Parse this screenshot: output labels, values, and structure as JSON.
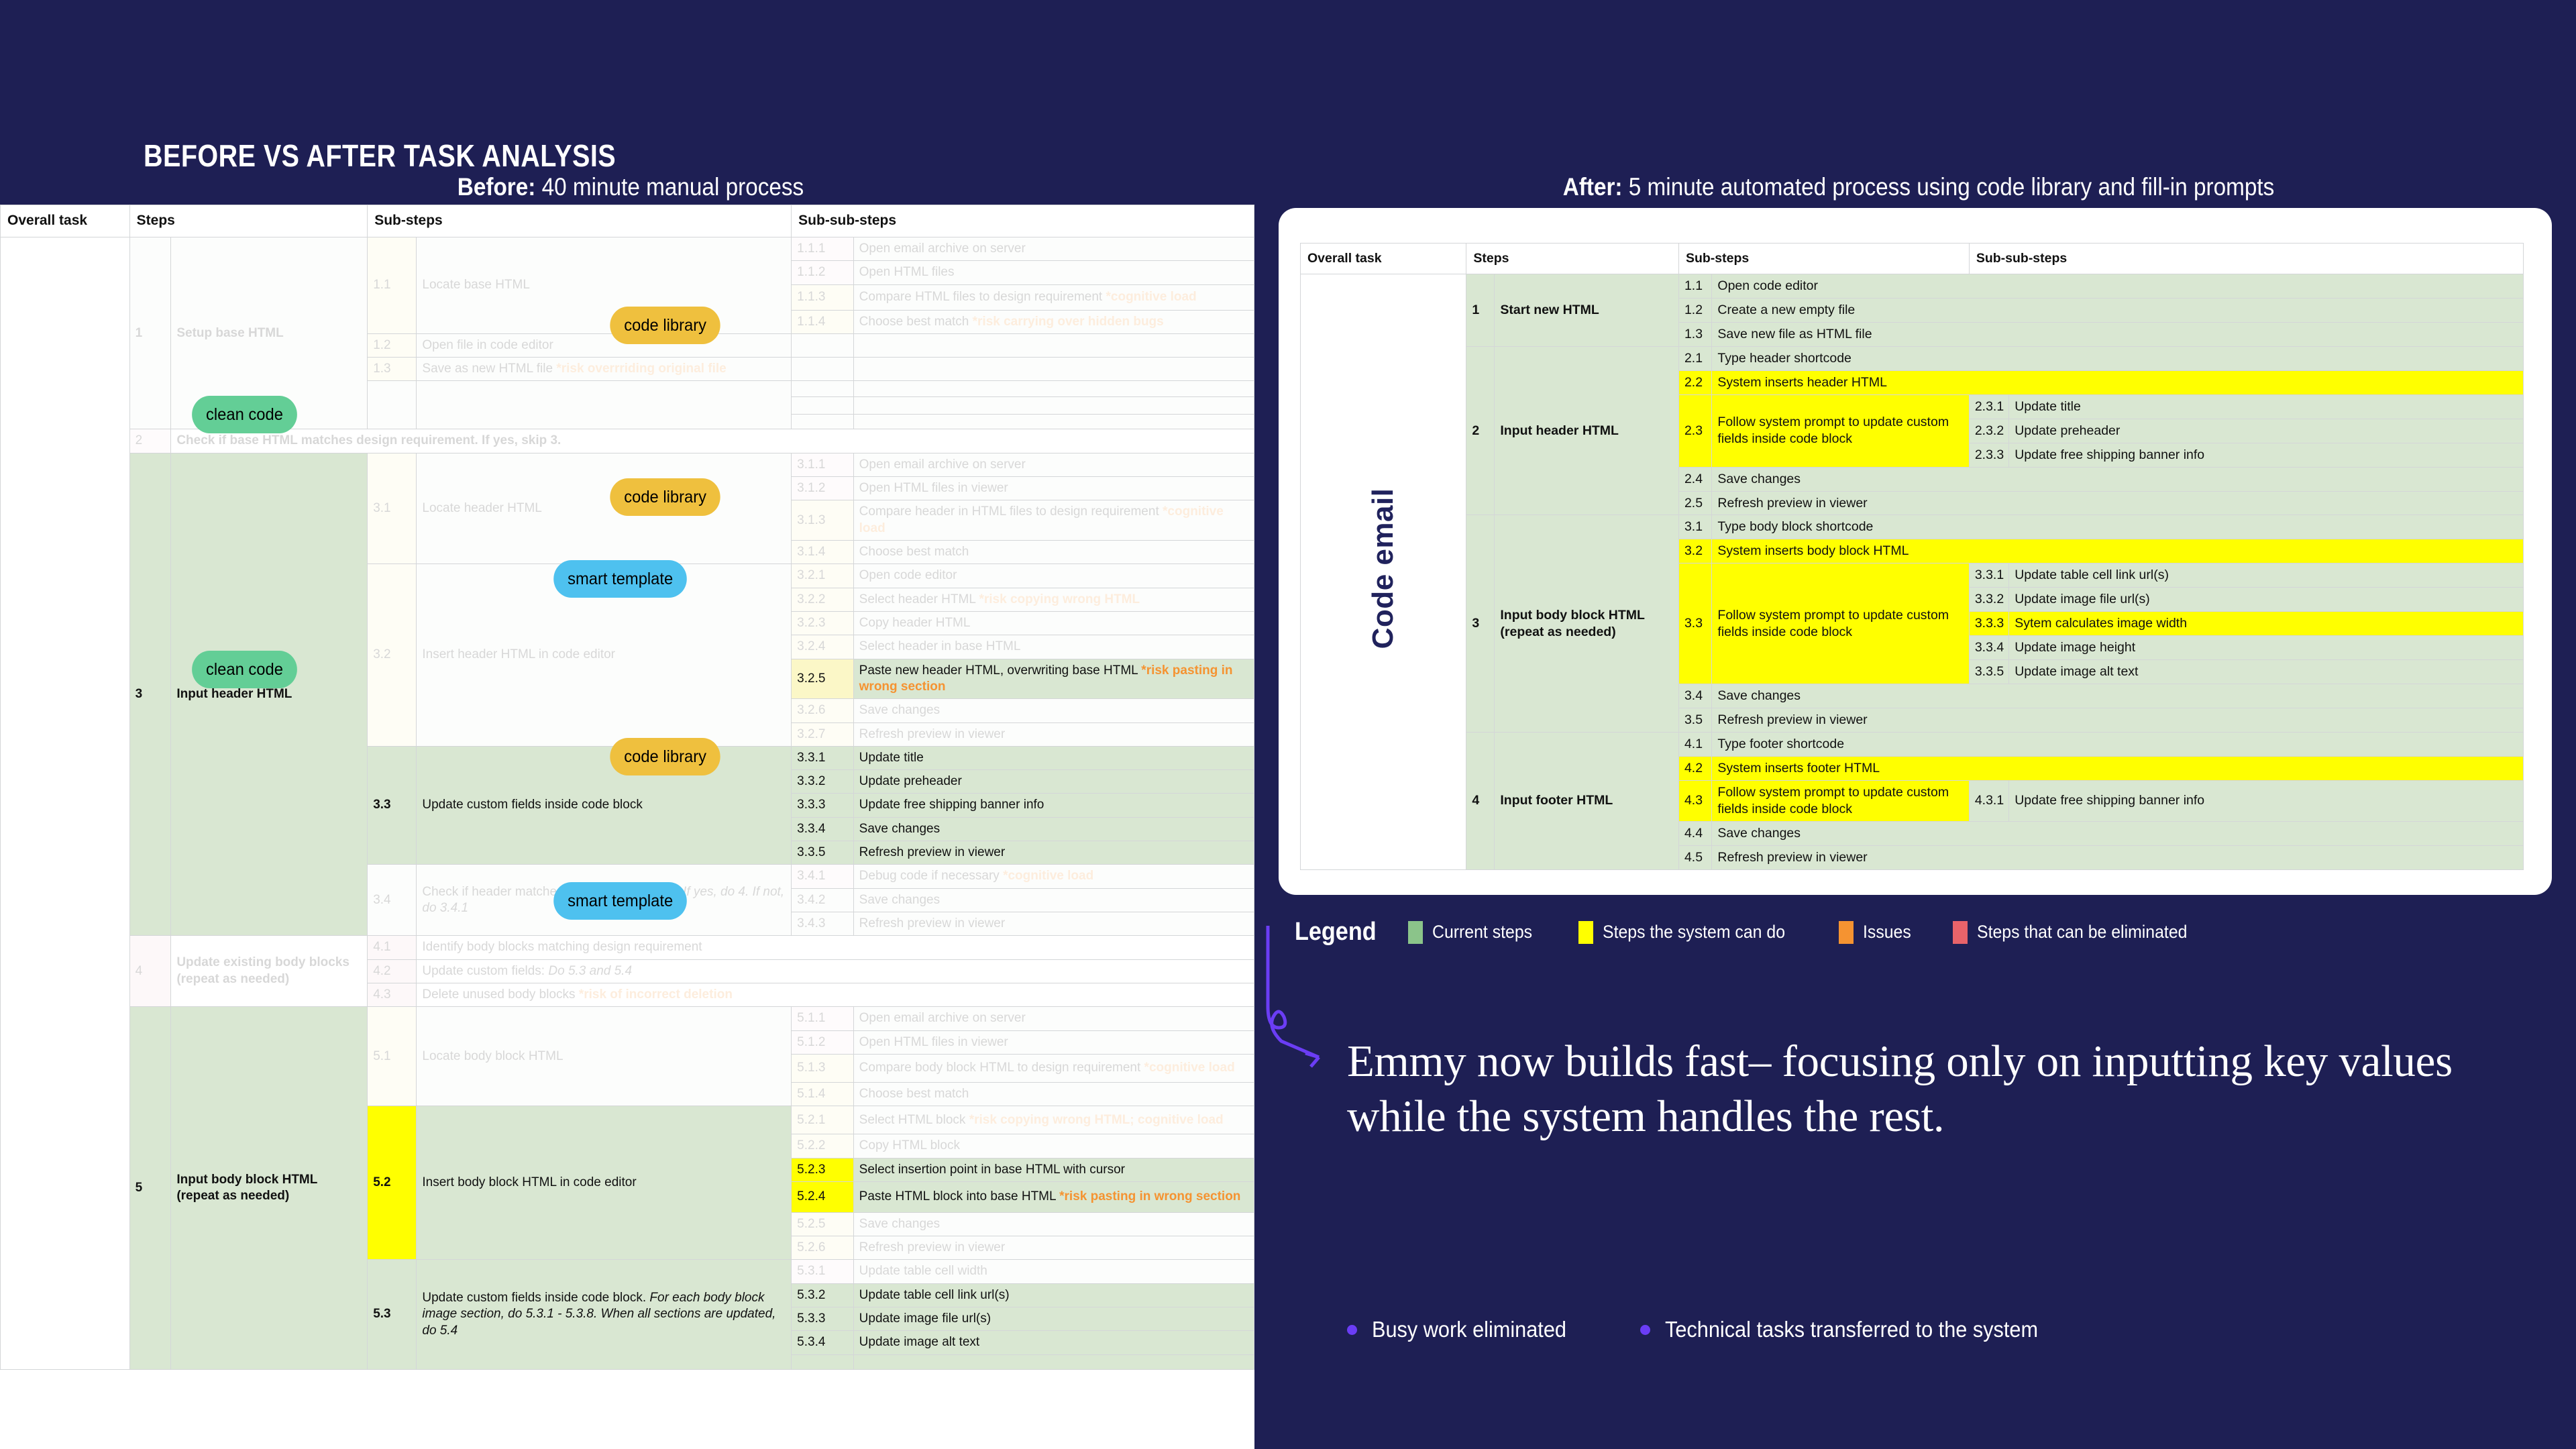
{
  "slide": {
    "title": "BEFORE VS AFTER TASK ANALYSIS",
    "before_caption_bold": "Before:",
    "before_caption_rest": " 40 minute manual process",
    "after_caption_bold": "After:",
    "after_caption_rest": " 5 minute automated process using code library and fill-in prompts"
  },
  "colors": {
    "page_bg": "#1e1f54",
    "current_steps": "#8bc48a",
    "system_can_do": "#ffff00",
    "issues": "#f59331",
    "eliminated": "#e8636a",
    "accent_purple": "#6b3df5",
    "pill_code_library": "#efc03e",
    "pill_clean_code": "#63ce96",
    "pill_smart_template": "#4ec1ef"
  },
  "before": {
    "vertical_label": "Code email",
    "headers": {
      "overall_task": "Overall task",
      "steps": "Steps",
      "sub_steps": "Sub-steps",
      "sub_sub_steps": "Sub-sub-steps"
    },
    "pills": [
      {
        "label": "code library",
        "kind": "code-library"
      },
      {
        "label": "clean code",
        "kind": "clean-code"
      },
      {
        "label": "code library",
        "kind": "code-library"
      },
      {
        "label": "smart template",
        "kind": "smart-template"
      },
      {
        "label": "clean code",
        "kind": "clean-code"
      },
      {
        "label": "code library",
        "kind": "code-library"
      },
      {
        "label": "smart template",
        "kind": "smart-template"
      }
    ],
    "steps": [
      {
        "n": "1",
        "label": "Setup base HTML"
      },
      {
        "n": "2",
        "label": "Check if base HTML matches design requirement. If yes, skip 3."
      },
      {
        "n": "3",
        "label": "Input header HTML"
      },
      {
        "n": "4",
        "label": "Update existing body blocks (repeat as needed)"
      },
      {
        "n": "5",
        "label": "Input body block HTML (repeat as needed)"
      }
    ],
    "sub_steps": [
      {
        "n": "1.1",
        "label": "Locate base HTML"
      },
      {
        "n": "1.2",
        "label": "Open file in code editor"
      },
      {
        "n": "1.3",
        "label": "Save as new HTML file",
        "risk": "*risk overrriding original file"
      },
      {
        "n": "3.1",
        "label": "Locate header HTML"
      },
      {
        "n": "3.2",
        "label": "Insert header HTML in code editor"
      },
      {
        "n": "3.3",
        "label": "Update custom fields inside code block"
      },
      {
        "n": "3.4",
        "label": "Check if header matches design requirement.",
        "italic": "If yes, do 4. If not, do 3.4.1"
      },
      {
        "n": "4.1",
        "label": "Identify body blocks matching design requirement"
      },
      {
        "n": "4.2",
        "label": "Update custom fields:",
        "italic": "Do 5.3 and 5.4"
      },
      {
        "n": "4.3",
        "label": "Delete unused body blocks",
        "risk": "*risk of incorrect deletion"
      },
      {
        "n": "5.1",
        "label": "Locate body block HTML"
      },
      {
        "n": "5.2",
        "label": "Insert body block HTML in code editor"
      },
      {
        "n": "5.3",
        "label": "Update custom fields inside code block.",
        "italic": "For each body block image section, do 5.3.1 - 5.3.8. When all sections are updated, do 5.4"
      }
    ],
    "sub_sub_steps": [
      {
        "n": "1.1.1",
        "label": "Open email archive on server"
      },
      {
        "n": "1.1.2",
        "label": "Open HTML files"
      },
      {
        "n": "1.1.3",
        "label": "Compare HTML files to design requirement",
        "risk": "*cognitive load"
      },
      {
        "n": "1.1.4",
        "label": "Choose best match",
        "risk": "*risk carrying over hidden bugs"
      },
      {
        "n": "3.1.1",
        "label": "Open email archive on server"
      },
      {
        "n": "3.1.2",
        "label": "Open HTML files in viewer"
      },
      {
        "n": "3.1.3",
        "label": "Compare header in HTML files to design requirement",
        "risk": "*cognitive load"
      },
      {
        "n": "3.1.4",
        "label": "Choose best match"
      },
      {
        "n": "3.2.1",
        "label": "Open code editor"
      },
      {
        "n": "3.2.2",
        "label": "Select header HTML",
        "risk": "*risk copying wrong HTML"
      },
      {
        "n": "3.2.3",
        "label": "Copy header HTML"
      },
      {
        "n": "3.2.4",
        "label": "Select header in base HTML"
      },
      {
        "n": "3.2.5",
        "label": "Paste new header HTML, overwriting base HTML",
        "risk": "*risk pasting in wrong section"
      },
      {
        "n": "3.2.6",
        "label": "Save changes"
      },
      {
        "n": "3.2.7",
        "label": "Refresh preview in viewer"
      },
      {
        "n": "3.3.1",
        "label": "Update title"
      },
      {
        "n": "3.3.2",
        "label": "Update preheader"
      },
      {
        "n": "3.3.3",
        "label": "Update free shipping banner info"
      },
      {
        "n": "3.3.4",
        "label": "Save changes"
      },
      {
        "n": "3.3.5",
        "label": "Refresh preview in viewer"
      },
      {
        "n": "3.4.1",
        "label": "Debug code if necessary",
        "risk": "*cognitive load"
      },
      {
        "n": "3.4.2",
        "label": "Save changes"
      },
      {
        "n": "3.4.3",
        "label": "Refresh preview in viewer"
      },
      {
        "n": "5.1.1",
        "label": "Open email archive on server"
      },
      {
        "n": "5.1.2",
        "label": "Open HTML files in viewer"
      },
      {
        "n": "5.1.3",
        "label": "Compare body block HTML to design requirement",
        "risk": "*cognitive load"
      },
      {
        "n": "5.1.4",
        "label": "Choose best match"
      },
      {
        "n": "5.2.1",
        "label": "Select HTML block",
        "risk": "*risk copying wrong HTML; cognitive load"
      },
      {
        "n": "5.2.2",
        "label": "Copy HTML block"
      },
      {
        "n": "5.2.3",
        "label": "Select insertion point in base HTML with cursor"
      },
      {
        "n": "5.2.4",
        "label": "Paste HTML block into base HTML",
        "risk": "*risk pasting in wrong section"
      },
      {
        "n": "5.2.5",
        "label": "Save changes"
      },
      {
        "n": "5.2.6",
        "label": "Refresh preview in viewer"
      },
      {
        "n": "5.3.1",
        "label": "Update table cell width"
      },
      {
        "n": "5.3.2",
        "label": "Update table cell link url(s)"
      },
      {
        "n": "5.3.3",
        "label": "Update image file url(s)"
      },
      {
        "n": "5.3.4",
        "label": "Update image alt text"
      }
    ]
  },
  "after": {
    "vertical_label": "Code email",
    "headers": {
      "overall_task": "Overall task",
      "steps": "Steps",
      "sub_steps": "Sub-steps",
      "sub_sub_steps": "Sub-sub-steps"
    },
    "rows": [
      {
        "step_n": "1",
        "step": "Start new HTML",
        "sub_n": "1.1",
        "sub": "Open code editor"
      },
      {
        "sub_n": "1.2",
        "sub": "Create a new empty file"
      },
      {
        "sub_n": "1.3",
        "sub": "Save new file as HTML file"
      },
      {
        "step_n": "2",
        "step": "Input header HTML",
        "sub_n": "2.1",
        "sub": "Type header shortcode"
      },
      {
        "sub_n": "2.2",
        "sub": "System inserts header HTML",
        "hl": true
      },
      {
        "sub_n": "2.3",
        "sub": "Follow system prompt to update custom fields inside code block",
        "hl": true,
        "ss": [
          {
            "n": "2.3.1",
            "label": "Update title"
          },
          {
            "n": "2.3.2",
            "label": "Update preheader"
          },
          {
            "n": "2.3.3",
            "label": "Update free shipping banner info"
          }
        ]
      },
      {
        "sub_n": "2.4",
        "sub": "Save changes"
      },
      {
        "sub_n": "2.5",
        "sub": "Refresh preview in viewer"
      },
      {
        "step_n": "3",
        "step": "Input body block HTML (repeat as needed)",
        "sub_n": "3.1",
        "sub": "Type body block shortcode"
      },
      {
        "sub_n": "3.2",
        "sub": "System inserts body block HTML",
        "hl": true
      },
      {
        "sub_n": "3.3",
        "sub": "Follow system prompt to update custom fields inside code block",
        "hl": true,
        "ss": [
          {
            "n": "3.3.1",
            "label": "Update table cell link url(s)"
          },
          {
            "n": "3.3.2",
            "label": "Update image file url(s)"
          },
          {
            "n": "3.3.3",
            "label": "Sytem calculates image width",
            "hl": true
          },
          {
            "n": "3.3.4",
            "label": "Update image height"
          },
          {
            "n": "3.3.5",
            "label": "Update image alt text"
          }
        ]
      },
      {
        "sub_n": "3.4",
        "sub": "Save changes"
      },
      {
        "sub_n": "3.5",
        "sub": "Refresh preview in viewer"
      },
      {
        "step_n": "4",
        "step": "Input footer HTML",
        "sub_n": "4.1",
        "sub": "Type footer shortcode"
      },
      {
        "sub_n": "4.2",
        "sub": "System inserts footer HTML",
        "hl": true
      },
      {
        "sub_n": "4.3",
        "sub": "Follow system prompt to update custom fields inside code block",
        "hl": true,
        "ss": [
          {
            "n": "4.3.1",
            "label": "Update free shipping banner info"
          }
        ]
      },
      {
        "sub_n": "4.4",
        "sub": "Save changes"
      },
      {
        "sub_n": "4.5",
        "sub": "Refresh preview in viewer"
      }
    ]
  },
  "legend": {
    "title": "Legend",
    "items": [
      {
        "label": "Current steps",
        "color": "#8bc48a"
      },
      {
        "label": "Steps the system can do",
        "color": "#ffff00"
      },
      {
        "label": "Issues",
        "color": "#f59331"
      },
      {
        "label": "Steps that can be eliminated",
        "color": "#e8636a"
      }
    ]
  },
  "callout": {
    "text": "Emmy now builds fast– focusing only on inputting key values while the system handles the rest.",
    "bullets": [
      "Busy work eliminated",
      "Technical tasks transferred to the system"
    ]
  }
}
